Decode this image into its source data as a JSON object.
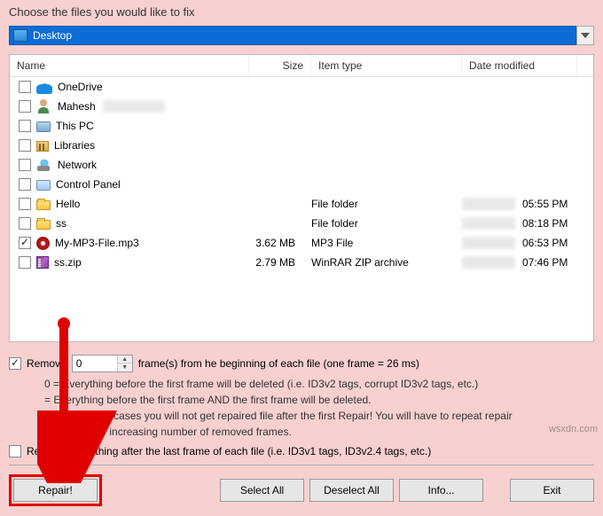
{
  "title": "Choose the files you would like to fix",
  "path": {
    "label": "Desktop"
  },
  "columns": {
    "name": "Name",
    "size": "Size",
    "type": "Item type",
    "date": "Date modified"
  },
  "files": [
    {
      "checked": false,
      "icon": "cloud",
      "name": "OneDrive",
      "size": "",
      "type": "",
      "date": ""
    },
    {
      "checked": false,
      "icon": "user",
      "name": "Mahesh",
      "size": "",
      "type": "",
      "date": ""
    },
    {
      "checked": false,
      "icon": "pc",
      "name": "This PC",
      "size": "",
      "type": "",
      "date": ""
    },
    {
      "checked": false,
      "icon": "lib",
      "name": "Libraries",
      "size": "",
      "type": "",
      "date": ""
    },
    {
      "checked": false,
      "icon": "net",
      "name": "Network",
      "size": "",
      "type": "",
      "date": ""
    },
    {
      "checked": false,
      "icon": "cp",
      "name": "Control Panel",
      "size": "",
      "type": "",
      "date": ""
    },
    {
      "checked": false,
      "icon": "folder",
      "name": "Hello",
      "size": "",
      "type": "File folder",
      "date": "05:55 PM",
      "blurdate": true
    },
    {
      "checked": false,
      "icon": "folder",
      "name": "ss",
      "size": "",
      "type": "File folder",
      "date": "08:18 PM",
      "blurdate": true
    },
    {
      "checked": true,
      "icon": "mp3",
      "name": "My-MP3-File.mp3",
      "size": "3.62 MB",
      "type": "MP3 File",
      "date": "06:53 PM",
      "blurdate": true
    },
    {
      "checked": false,
      "icon": "zip",
      "name": "ss.zip",
      "size": "2.79 MB",
      "type": "WinRAR ZIP archive",
      "date": "07:46 PM",
      "blurdate": true
    }
  ],
  "remove": {
    "checked": true,
    "label": "Remove",
    "value": "0",
    "suffix": "frame(s) from he beginning of each file (one frame = 26 ms)"
  },
  "notes": {
    "l1": "0 = Everything before the first frame will be deleted (i.e. ID3v2 tags, corrupt ID3v2 tags, etc.)",
    "l2": "   = Everything before the first frame AND the first frame will be deleted.",
    "l3": "Note: In some cases you will not get repaired file after the first Repair! You will have to repeat repair",
    "l4": "procedure by increasing number of removed frames."
  },
  "removeEvery": {
    "checked": false,
    "label": "Remove everything after the last frame of each file (i.e. ID3v1 tags, ID3v2.4 tags, etc.)"
  },
  "buttons": {
    "repair": "Repair!",
    "selectAll": "Select All",
    "deselectAll": "Deselect All",
    "info": "Info...",
    "exit": "Exit"
  },
  "watermark": "wsxdn.com"
}
